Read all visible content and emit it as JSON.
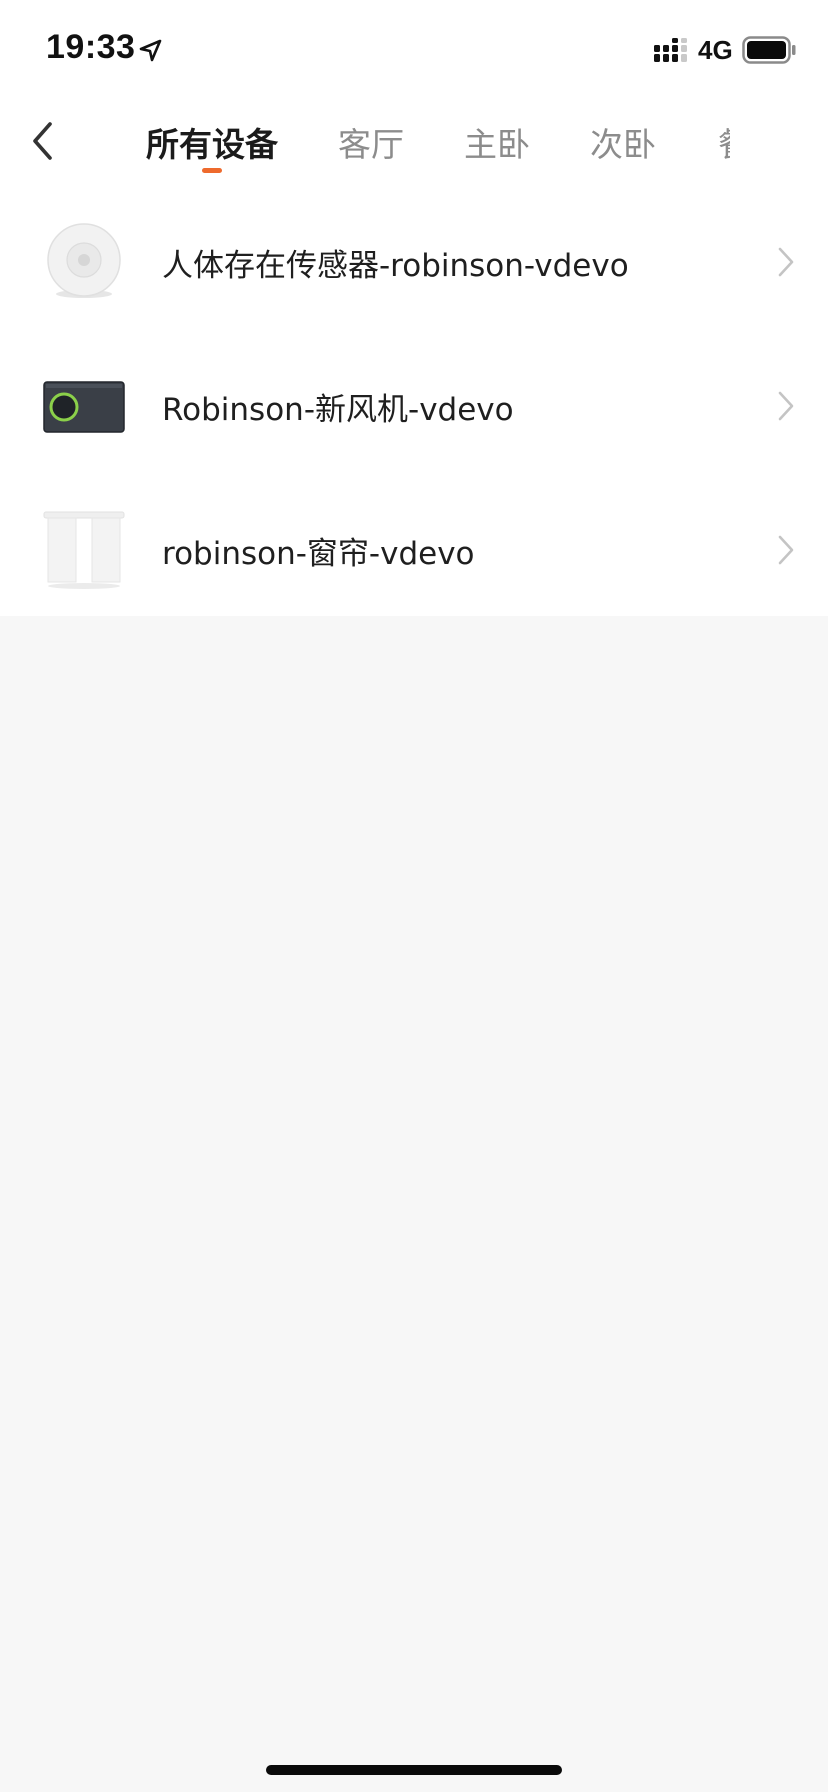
{
  "status_bar": {
    "time": "19:33",
    "network": "4G",
    "icons": [
      "location-arrow-icon",
      "signal-icon",
      "battery-icon"
    ]
  },
  "nav": {
    "back_icon": "chevron-left-icon",
    "tabs": [
      {
        "label": "所有设备",
        "active": true
      },
      {
        "label": "客厅",
        "active": false
      },
      {
        "label": "主卧",
        "active": false
      },
      {
        "label": "次卧",
        "active": false
      },
      {
        "label": "餐",
        "active": false
      }
    ]
  },
  "devices": [
    {
      "name": "人体存在传感器-robinson-vdevo",
      "icon": "presence-sensor-icon"
    },
    {
      "name": "Robinson-新风机-vdevo",
      "icon": "fresh-air-unit-icon"
    },
    {
      "name": "robinson-窗帘-vdevo",
      "icon": "curtain-icon"
    }
  ],
  "colors": {
    "accent": "#ee6a2d",
    "background": "#f7f7f7",
    "card": "#ffffff",
    "text_primary": "#1f1f1f",
    "text_inactive": "#8c8c8c"
  }
}
